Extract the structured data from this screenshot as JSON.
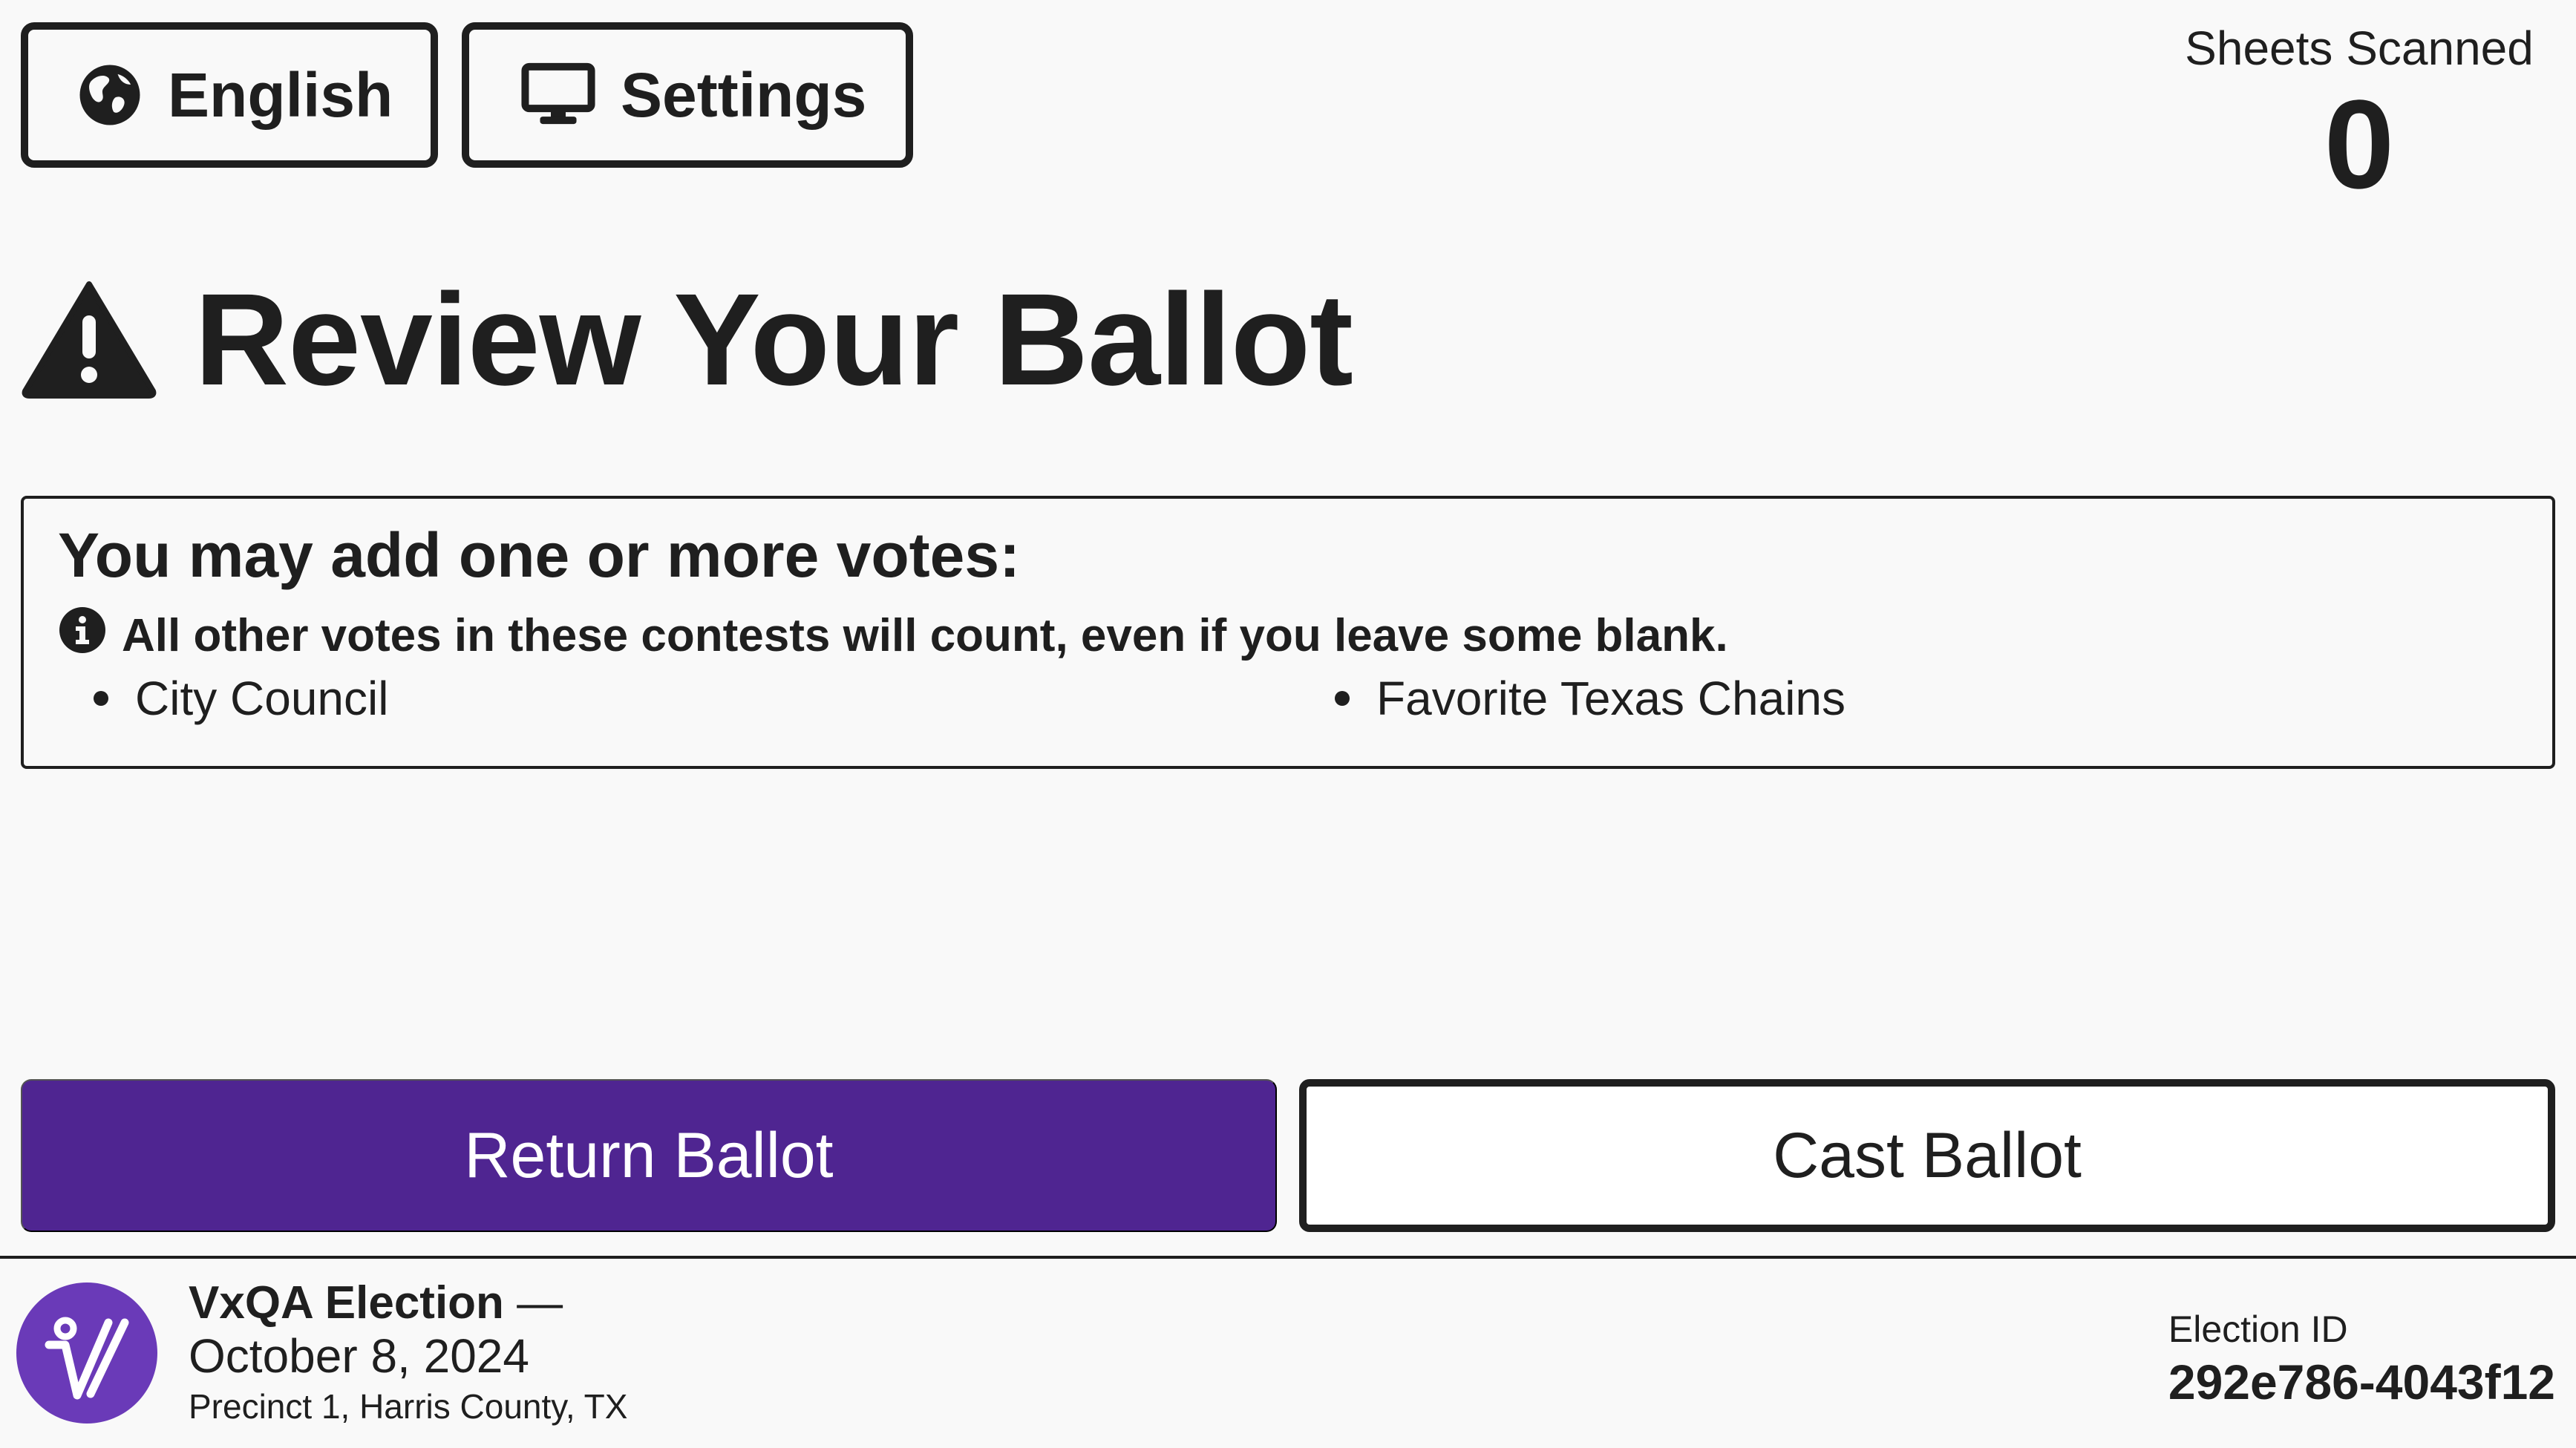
{
  "header": {
    "language_label": "English",
    "settings_label": "Settings",
    "sheets_scanned_label": "Sheets Scanned",
    "sheets_scanned_count": "0"
  },
  "page": {
    "title": "Review Your Ballot"
  },
  "notice": {
    "heading": "You may add one or more votes:",
    "info_text": "All other votes in these contests will count, even if you leave some blank.",
    "contests": [
      "City Council",
      "Favorite Texas Chains"
    ]
  },
  "actions": {
    "return_label": "Return Ballot",
    "cast_label": "Cast Ballot"
  },
  "footer": {
    "election_name": "VxQA Election",
    "election_name_dash": "—",
    "election_date": "October 8, 2024",
    "precinct": "Precinct 1, Harris County, TX",
    "election_id_label": "Election ID",
    "election_id": "292e786-4043f12"
  },
  "colors": {
    "primary_button": "#4f2591",
    "logo_circle": "#6a3ab8",
    "text": "#1f1f1f",
    "background": "#f9f9f9"
  },
  "icons": {
    "language": "globe-icon",
    "settings": "monitor-icon",
    "warning": "warning-triangle-icon",
    "info": "info-icon",
    "logo": "vx-logo"
  }
}
